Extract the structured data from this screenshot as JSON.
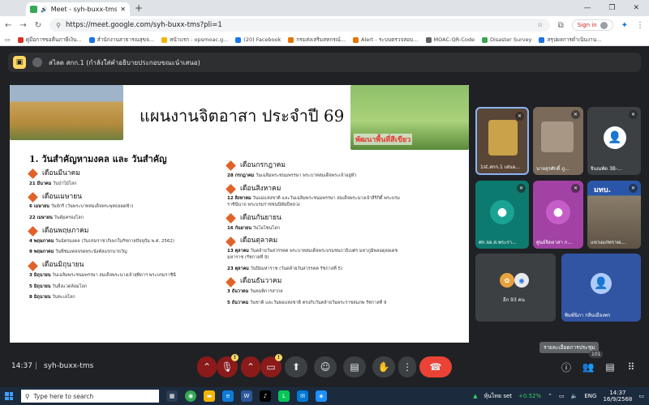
{
  "browser": {
    "tab_title": "Meet - syh-buxx-tms",
    "url": "https://meet.google.com/syh-buxx-tms?pli=1",
    "signin_label": "Sign in",
    "bookmarks": [
      {
        "label": "คู่มือการขอคืนภาษีเงิน...",
        "color": "#d93025"
      },
      {
        "label": "สำนักงานสาธารณสุขจ...",
        "color": "#1a73e8"
      },
      {
        "label": "หน้าแรก - opsmoac.g...",
        "color": "#f4b400"
      },
      {
        "label": "(20) Facebook",
        "color": "#1877f2"
      },
      {
        "label": "กรมส่งเสริมสหกรณ์...",
        "color": "#e37400"
      },
      {
        "label": "Alert - ระบบตรวจสอบ...",
        "color": "#e37400"
      },
      {
        "label": "MOAC-QR-Code",
        "color": "#5f6368"
      },
      {
        "label": "Disaster Survey",
        "color": "#34a853"
      },
      {
        "label": "สรุปผลการดำเนินงาน...",
        "color": "#1a73e8"
      }
    ]
  },
  "meet": {
    "presenter_banner": "สไลด สกก.1 (กำลังใส่คำอธิบายประกอบขณะนำเสนอ)",
    "slide": {
      "title": "แผนงานจิตอาสา ประจำปี 69",
      "photo_caption": "พัฒนาพื้นที่สีเขียว",
      "subtitle": "1. วันสำคัญหามงคล และ วันสำคัญ",
      "left_months": [
        {
          "month": "เดือนมีนาคม",
          "events": [
            {
              "date": "21 มีนาคม",
              "text": "วันป่าไม้โลก"
            }
          ]
        },
        {
          "month": "เดือนเมษายน",
          "events": [
            {
              "date": "6 เมษายน",
              "text": "วันจักรี (วันพระบาทสมเด็จพระพุทธยอดฟ้า)"
            },
            {
              "date": "22 เมษายน",
              "text": "วันคุ้มครองโลก"
            }
          ]
        },
        {
          "month": "เดือนพฤษภาคม",
          "events": [
            {
              "date": "4 พฤษภาคม",
              "text": "วันฉัตรมงคล (วันบรมราชาภิเษกในรัชกาลปัจจุบัน พ.ศ. 2562)"
            },
            {
              "date": "9 พฤษภาคม",
              "text": "วันพืชมงคลจรดพระนังคัลแรกนาขวัญ"
            }
          ]
        },
        {
          "month": "เดือนมิถุนายน",
          "events": [
            {
              "date": "3 มิถุนายน",
              "text": "วันเฉลิมพระชนมพรรษา สมเด็จพระนางเจ้าสุทิดาฯ พระบรมราชินี"
            },
            {
              "date": "5 มิถุนายน",
              "text": "วันสิ่งแวดล้อมโลก"
            },
            {
              "date": "8 มิถุนายน",
              "text": "วันทะเลโลก"
            }
          ]
        }
      ],
      "right_months": [
        {
          "month": "เดือนกรกฎาคม",
          "events": [
            {
              "date": "28 กรกฎาคม",
              "text": "วันเฉลิมพระชนมพรรษา พระบาทสมเด็จพระเจ้าอยู่หัว"
            }
          ]
        },
        {
          "month": "เดือนสิงหาคม",
          "events": [
            {
              "date": "12 สิงหาคม",
              "text": "วันแม่แห่งชาติ และวันเฉลิมพระชนมพรรษา สมเด็จพระนางเจ้าสิริกิติ์ พระบรมราชินีนาถ พระบรมราชชนนีพันปีหลวง"
            }
          ]
        },
        {
          "month": "เดือนกันยายน",
          "events": [
            {
              "date": "16 กันยายน",
              "text": "วันโอโซนโลก"
            }
          ]
        },
        {
          "month": "เดือนตุลาคม",
          "events": [
            {
              "date": "13 ตุลาคม",
              "text": "วันคล้ายวันสวรรคต พระบาทสมเด็จพระบรมชนกาธิเบศร มหาภูมิพลอดุลยเดชมหาราช (รัชกาลที่ 9)"
            },
            {
              "date": "23 ตุลาคม",
              "text": "วันปิยมหาราช (วันคล้ายวันสวรรคต รัชกาลที่ 5)"
            }
          ]
        },
        {
          "month": "เดือนธันวาคม",
          "events": [
            {
              "date": "3 ธันวาคม",
              "text": "วันคนพิการสากล"
            },
            {
              "date": "5 ธันวาคม",
              "text": "วันชาติ และวันพ่อแห่งชาติ ตรงกับวันคล้ายวันพระราชสมภพ รัชกาลที่ 9"
            }
          ]
        }
      ]
    },
    "participants": [
      {
        "name": "1st.สกก.1 เสนอ...",
        "bg": "#5a4636"
      },
      {
        "name": "นายสุรศักดิ์ ภู...",
        "bg": "#7a6a5a"
      },
      {
        "name": "จินณพัต 3B-...",
        "bg": "#3c4043"
      },
      {
        "name": "ศก.จอ.ส.พระรา...",
        "bg": "#0d7a6f"
      },
      {
        "name": "ศูนย์จิตอาสา ก...",
        "bg": "#a142a4"
      },
      {
        "name": "แขวงแก่ทรายเ...",
        "bg": "#6b6255"
      },
      {
        "name": "อีก 93 คน",
        "bg": "#3c4043"
      },
      {
        "name": "พิมพ์นิภา กลิ่นเมืองพร",
        "bg": "#3154a3"
      }
    ],
    "tile_text": {
      "moac": "มทบ."
    },
    "clock": "14:37",
    "separator": "|",
    "meeting_code": "syh-buxx-tms",
    "tooltip": "รายละเอียดการประชุม",
    "participant_count": "101"
  },
  "taskbar": {
    "search_placeholder": "Type here to search",
    "stock_name": "หุ้นไทย set",
    "stock_change": "+0.52%",
    "language": "ENG",
    "time": "14:37",
    "date": "16/9/2568"
  }
}
